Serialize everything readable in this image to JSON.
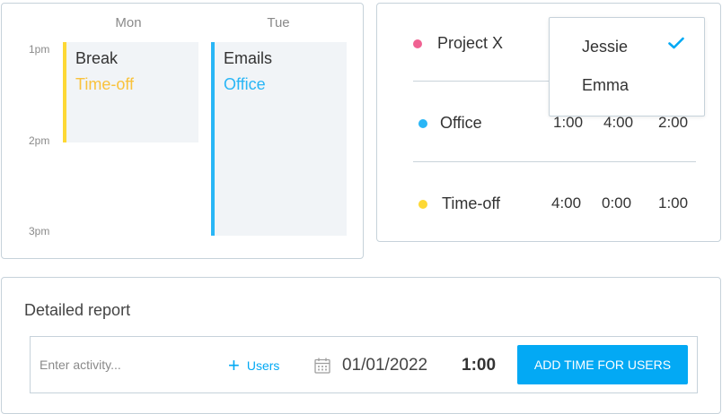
{
  "calendar": {
    "days": [
      "Mon",
      "Tue"
    ],
    "time_labels": [
      "1pm",
      "2pm",
      "3pm"
    ],
    "events": [
      {
        "title": "Break",
        "project": "Time-off",
        "project_color": "#f9c23c",
        "bar_color": "#fdd835"
      },
      {
        "title": "Emails",
        "project": "Office",
        "project_color": "#29b6f6",
        "bar_color": "#29b6f6"
      }
    ]
  },
  "summary": {
    "rows": [
      {
        "label": "Project X",
        "dot_color": "#f06292",
        "values": [
          "",
          "",
          ""
        ]
      },
      {
        "label": "Office",
        "dot_color": "#29b6f6",
        "values": [
          "1:00",
          "4:00",
          "2:00"
        ]
      },
      {
        "label": "Time-off",
        "dot_color": "#fdd835",
        "values": [
          "4:00",
          "0:00",
          "1:00"
        ]
      }
    ]
  },
  "user_dropdown": {
    "options": [
      "Jessie",
      "Emma"
    ],
    "selected": "Jessie",
    "check_icon": "check-icon"
  },
  "report": {
    "title": "Detailed report",
    "activity_placeholder": "Enter activity...",
    "users_label": "Users",
    "date": "01/01/2022",
    "duration": "1:00",
    "add_button_label": "ADD TIME FOR USERS",
    "accent_color": "#03a9f4"
  }
}
